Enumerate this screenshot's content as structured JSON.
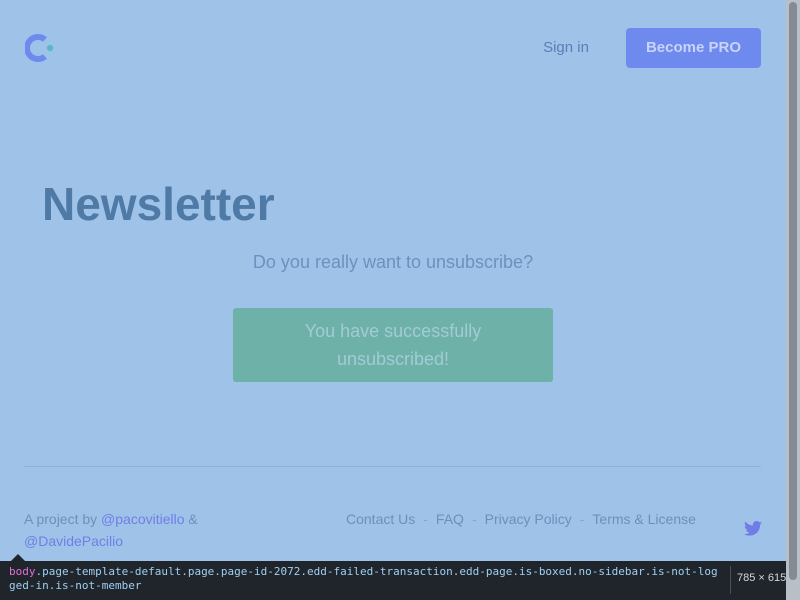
{
  "header": {
    "logo_icon": "brand-logo-icon",
    "signin_label": "Sign in",
    "pro_label": "Become PRO"
  },
  "main": {
    "title": "Newsletter",
    "question": "Do you really want to unsubscribe?",
    "success_message": "You have successfully unsubscribed!"
  },
  "footer": {
    "credits_prefix": "A project by ",
    "author1": "@pacovitiello",
    "credits_joiner": " &",
    "author2": "@DavidePacilio",
    "links": [
      "Contact Us",
      "FAQ",
      "Privacy Policy",
      "Terms & License"
    ],
    "separator": "-",
    "twitter_icon": "twitter-icon"
  },
  "devtools": {
    "selector_tag": "body",
    "selector_classes": ".page-template-default.page.page-id-2072.edd-failed-transaction.edd-page.is-boxed.no-sidebar.is-not-logged-in.is-not-member",
    "size": "785 × 615"
  },
  "colors": {
    "background": "#9fc3e8",
    "accent": "#6f8aee",
    "success": "#6db1a9",
    "title": "#4f7aa6"
  }
}
